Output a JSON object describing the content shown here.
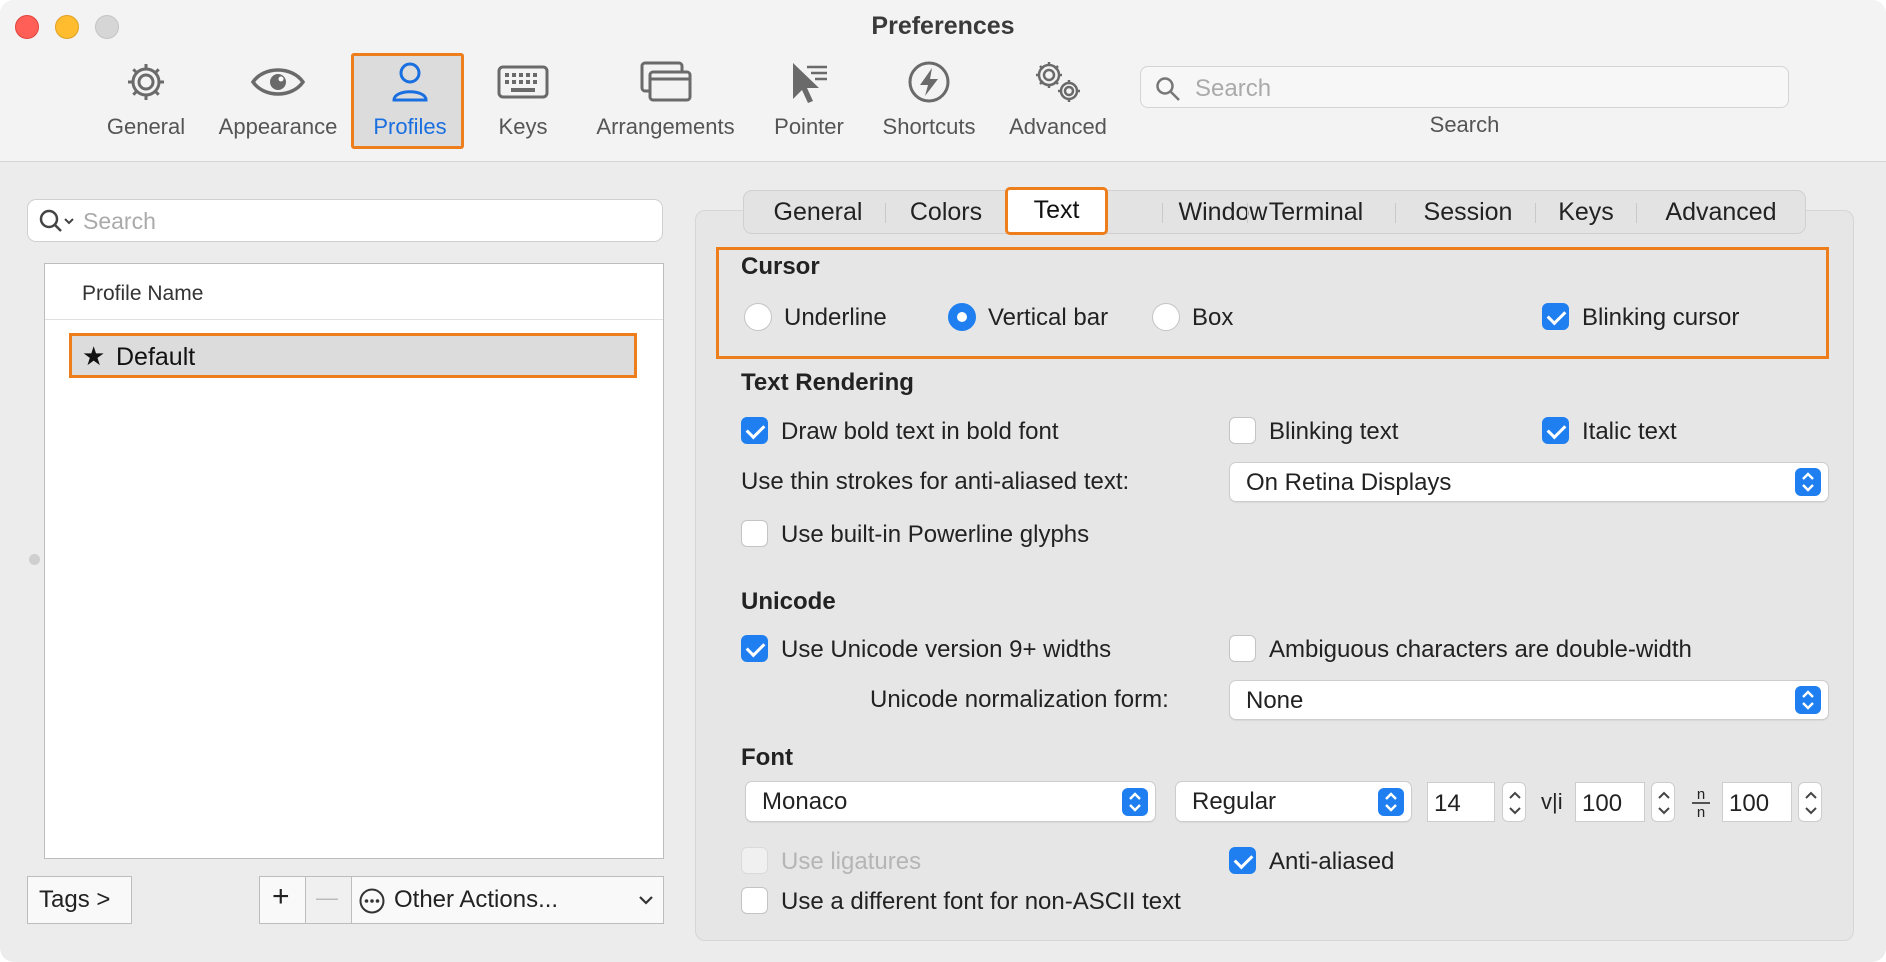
{
  "window": {
    "title": "Preferences"
  },
  "toolbar": {
    "items": [
      {
        "label": "General",
        "icon": "gear-icon"
      },
      {
        "label": "Appearance",
        "icon": "eye-icon"
      },
      {
        "label": "Profiles",
        "icon": "person-icon",
        "selected": true
      },
      {
        "label": "Keys",
        "icon": "keyboard-icon"
      },
      {
        "label": "Arrangements",
        "icon": "window-arrangement-icon"
      },
      {
        "label": "Pointer",
        "icon": "pointer-icon"
      },
      {
        "label": "Shortcuts",
        "icon": "lightning-icon"
      },
      {
        "label": "Advanced",
        "icon": "gears-icon"
      }
    ],
    "search": {
      "placeholder": "Search",
      "label": "Search"
    }
  },
  "profiles": {
    "search_placeholder": "Search",
    "column_header": "Profile Name",
    "rows": [
      {
        "name": "Default",
        "default": true
      }
    ],
    "tags_button": "Tags >",
    "add_button": "+",
    "remove_button": "—",
    "other_actions": "Other Actions..."
  },
  "tabs": [
    {
      "label": "General"
    },
    {
      "label": "Colors"
    },
    {
      "label": "Text",
      "selected": true
    },
    {
      "label": "Window"
    },
    {
      "label": "Terminal"
    },
    {
      "label": "Session"
    },
    {
      "label": "Keys"
    },
    {
      "label": "Advanced"
    }
  ],
  "cursor": {
    "title": "Cursor",
    "options": [
      {
        "label": "Underline",
        "selected": false
      },
      {
        "label": "Vertical bar",
        "selected": true
      },
      {
        "label": "Box",
        "selected": false
      }
    ],
    "blinking": {
      "label": "Blinking cursor",
      "checked": true
    }
  },
  "text_rendering": {
    "title": "Text Rendering",
    "bold": {
      "label": "Draw bold text in bold font",
      "checked": true
    },
    "blinking_text": {
      "label": "Blinking text",
      "checked": false
    },
    "italic": {
      "label": "Italic text",
      "checked": true
    },
    "thin_strokes_label": "Use thin strokes for anti-aliased text:",
    "thin_strokes_value": "On Retina Displays",
    "powerline": {
      "label": "Use built-in Powerline glyphs",
      "checked": false
    }
  },
  "unicode": {
    "title": "Unicode",
    "v9_widths": {
      "label": "Use Unicode version 9+ widths",
      "checked": true
    },
    "ambiguous": {
      "label": "Ambiguous characters are double-width",
      "checked": false
    },
    "normalization_label": "Unicode normalization form:",
    "normalization_value": "None"
  },
  "font": {
    "title": "Font",
    "family": "Monaco",
    "style": "Regular",
    "size": "14",
    "vertical_spacing_label": "v|i",
    "vertical_spacing": "100",
    "horizontal_spacing_label": "n/n",
    "horizontal_spacing": "100",
    "ligatures": {
      "label": "Use ligatures",
      "checked": false,
      "disabled": true
    },
    "anti_aliased": {
      "label": "Anti-aliased",
      "checked": true
    },
    "non_ascii": {
      "label": "Use a different font for non-ASCII text",
      "checked": false
    }
  },
  "colors": {
    "accent": "#1f7ff0",
    "highlight": "#ee7d1c",
    "selected_label": "#1a6fe0"
  }
}
